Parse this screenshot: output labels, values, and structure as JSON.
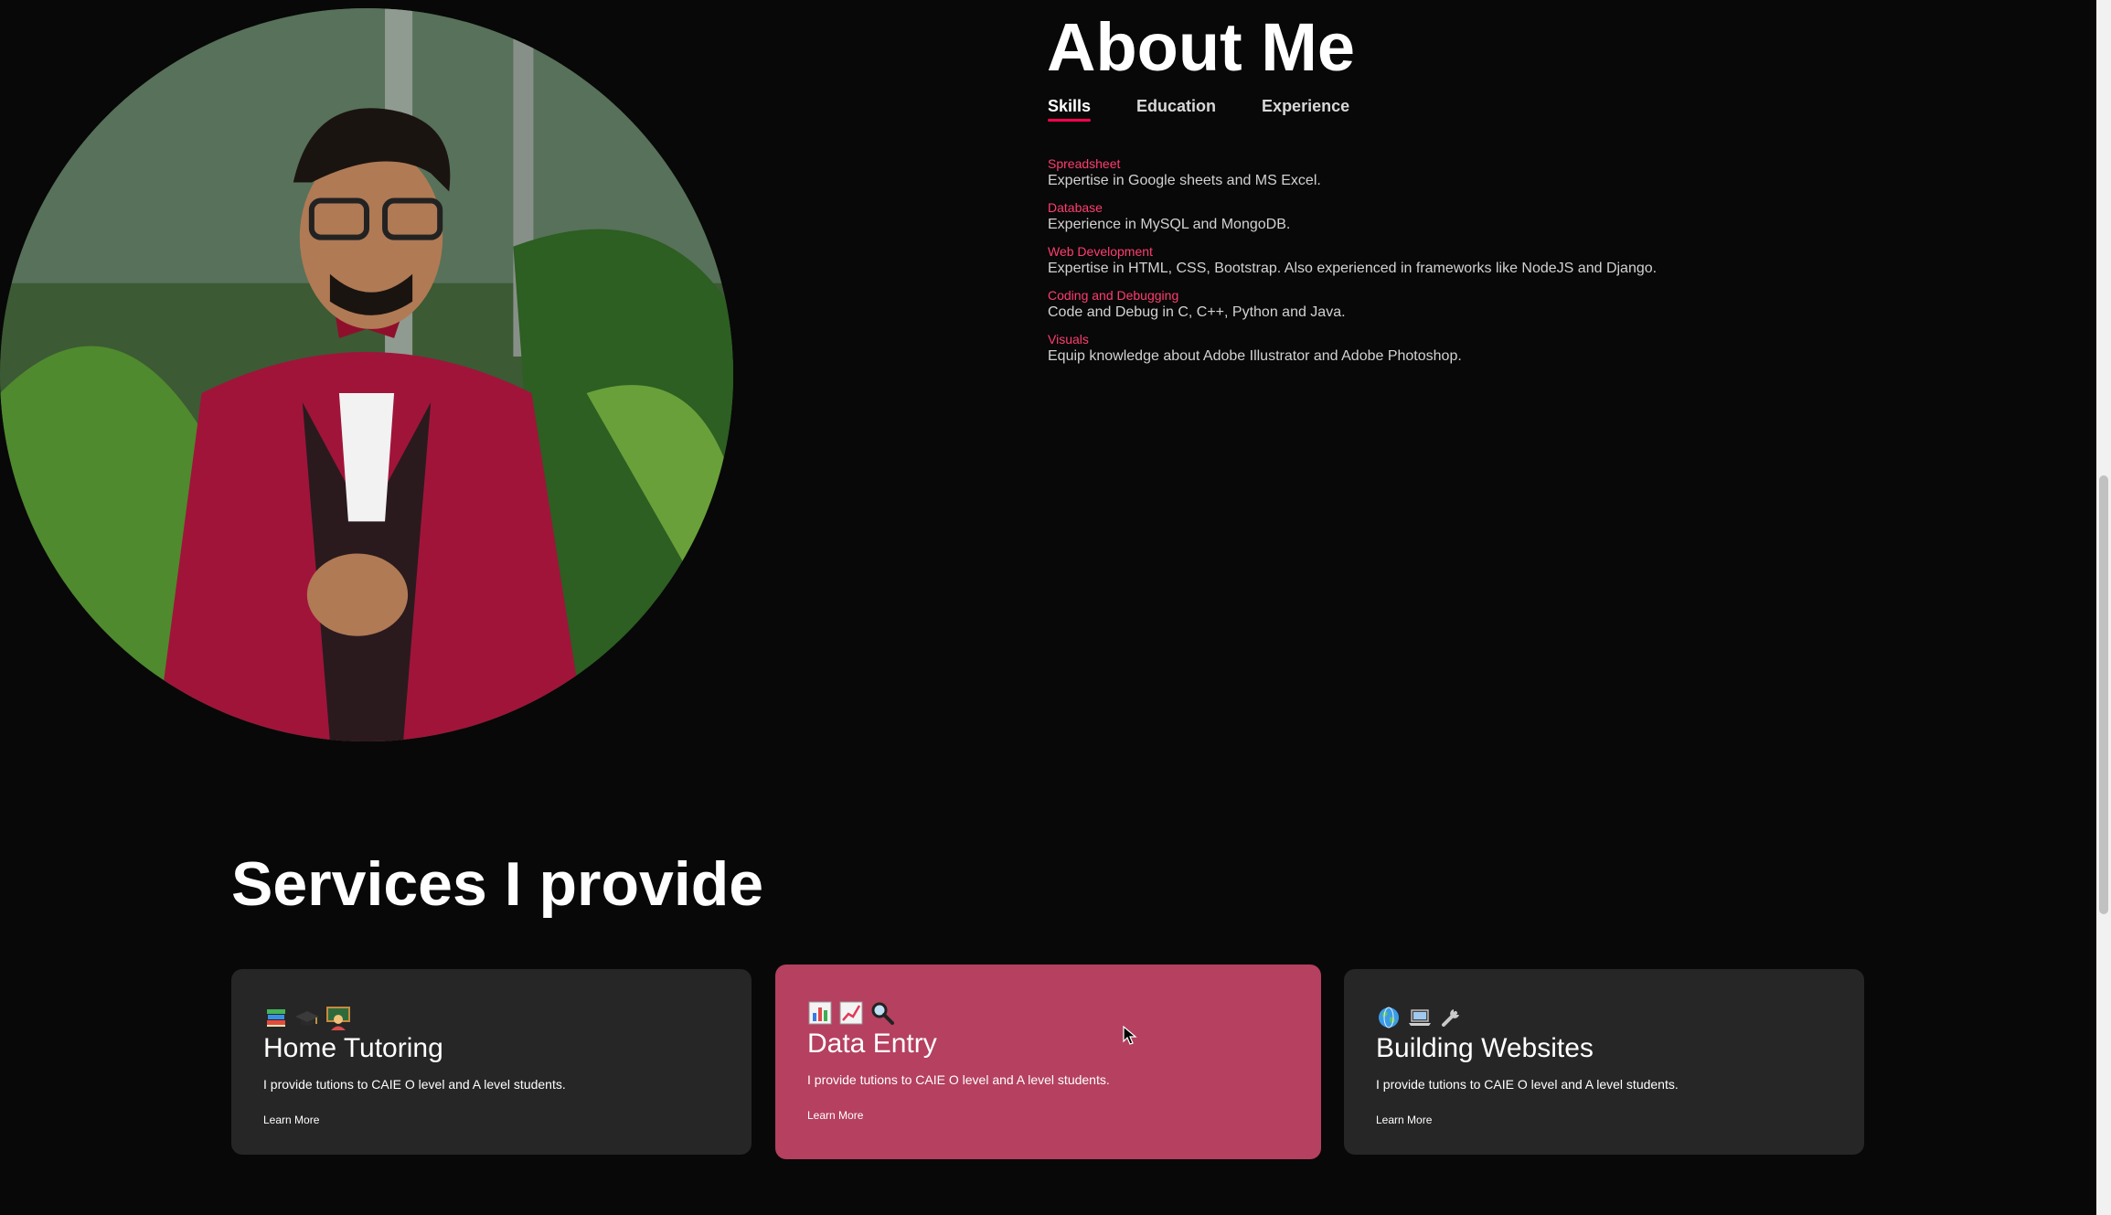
{
  "about": {
    "title": "About Me",
    "tabs": [
      {
        "label": "Skills",
        "active": true
      },
      {
        "label": "Education",
        "active": false
      },
      {
        "label": "Experience",
        "active": false
      }
    ],
    "skills": [
      {
        "name": "Spreadsheet",
        "desc": "Expertise in Google sheets and MS Excel."
      },
      {
        "name": "Database",
        "desc": "Experience in MySQL and MongoDB."
      },
      {
        "name": "Web Development",
        "desc": "Expertise in HTML, CSS, Bootstrap. Also experienced in frameworks like NodeJS and Django."
      },
      {
        "name": "Coding and Debugging",
        "desc": "Code and Debug in C, C++, Python and Java."
      },
      {
        "name": "Visuals",
        "desc": "Equip knowledge about Adobe Illustrator and Adobe Photoshop."
      }
    ]
  },
  "services": {
    "title": "Services I provide",
    "cards": [
      {
        "title": "Home Tutoring",
        "text": "I provide tutions to CAIE O level and A level students.",
        "link": "Learn More",
        "icons": [
          "books-icon",
          "graduation-cap-icon",
          "teacher-icon"
        ]
      },
      {
        "title": "Data Entry",
        "text": "I provide tutions to CAIE O level and A level students.",
        "link": "Learn More",
        "icons": [
          "bar-chart-icon",
          "line-chart-icon",
          "magnifier-icon"
        ]
      },
      {
        "title": "Building Websites",
        "text": "I provide tutions to CAIE O level and A level students.",
        "link": "Learn More",
        "icons": [
          "globe-icon",
          "laptop-icon",
          "wrench-icon"
        ]
      }
    ]
  },
  "colors": {
    "background": "#080808",
    "accent": "#ff004f",
    "card": "#262626",
    "card_hover": "#b5405f"
  }
}
